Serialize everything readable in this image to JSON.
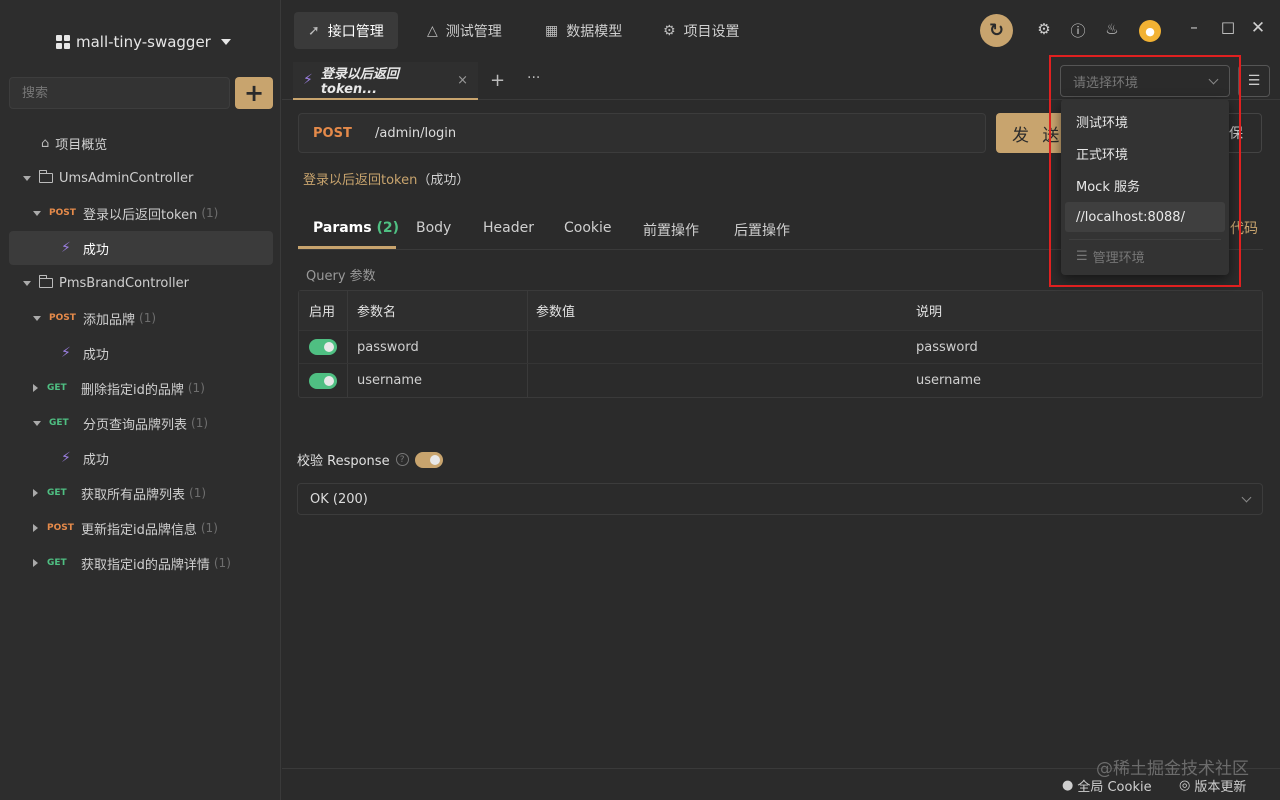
{
  "sidebar": {
    "project_title": "mall-tiny-swagger",
    "search_placeholder": "搜索",
    "add_label": "+",
    "overview": "项目概览",
    "tree": [
      {
        "kind": "folder",
        "label": "UmsAdminController"
      },
      {
        "kind": "api",
        "method": "POST",
        "label": "登录以后返回token",
        "count": "(1)"
      },
      {
        "kind": "case",
        "label": "成功",
        "selected": true
      },
      {
        "kind": "folder",
        "label": "PmsBrandController"
      },
      {
        "kind": "api",
        "method": "POST",
        "label": "添加品牌",
        "count": "(1)"
      },
      {
        "kind": "case",
        "label": "成功"
      },
      {
        "kind": "api",
        "method": "GET",
        "label": "删除指定id的品牌",
        "count": "(1)"
      },
      {
        "kind": "api",
        "method": "GET",
        "label": "分页查询品牌列表",
        "count": "(1)"
      },
      {
        "kind": "case",
        "label": "成功"
      },
      {
        "kind": "api",
        "method": "GET",
        "label": "获取所有品牌列表",
        "count": "(1)"
      },
      {
        "kind": "api",
        "method": "POST",
        "label": "更新指定id品牌信息",
        "count": "(1)"
      },
      {
        "kind": "api",
        "method": "GET",
        "label": "获取指定id的品牌详情",
        "count": "(1)"
      }
    ]
  },
  "topnav": {
    "tabs": [
      {
        "label": "接口管理",
        "icon": "rocket-icon"
      },
      {
        "label": "测试管理",
        "icon": "flask-icon"
      },
      {
        "label": "数据模型",
        "icon": "model-icon"
      },
      {
        "label": "项目设置",
        "icon": "gear-icon"
      }
    ]
  },
  "doc_tab": {
    "label": "登录以后返回token...",
    "close": "×"
  },
  "env": {
    "placeholder": "请选择环境",
    "options": [
      "测试环境",
      "正式环境",
      "Mock 服务",
      "//localhost:8088/"
    ],
    "manage_label": "管理环境"
  },
  "request": {
    "method": "POST",
    "path": "/admin/login",
    "send_label": "发 送",
    "save_fragment": "保",
    "api_name": "登录以后返回token",
    "api_status": "（成功）"
  },
  "subtabs": {
    "params_label": "Params",
    "params_count": "(2)",
    "body": "Body",
    "header": "Header",
    "cookie": "Cookie",
    "pre": "前置操作",
    "post": "后置操作",
    "code_fragment": "代码"
  },
  "params": {
    "section_label": "Query 参数",
    "headers": [
      "启用",
      "参数名",
      "参数值",
      "说明"
    ],
    "rows": [
      {
        "name": "password",
        "value": "",
        "desc": "password",
        "enabled": true
      },
      {
        "name": "username",
        "value": "",
        "desc": "username",
        "enabled": true
      }
    ]
  },
  "validate": {
    "label": "校验 Response",
    "enabled": true,
    "response": "OK (200)"
  },
  "footer": {
    "cookie": "全局 Cookie",
    "update": "版本更新",
    "watermark": "@稀土掘金技术社区"
  },
  "colors": {
    "accent": "#c8a46e",
    "post": "#e58a4a",
    "get": "#4fbf82",
    "highlight_box": "#e02020"
  }
}
